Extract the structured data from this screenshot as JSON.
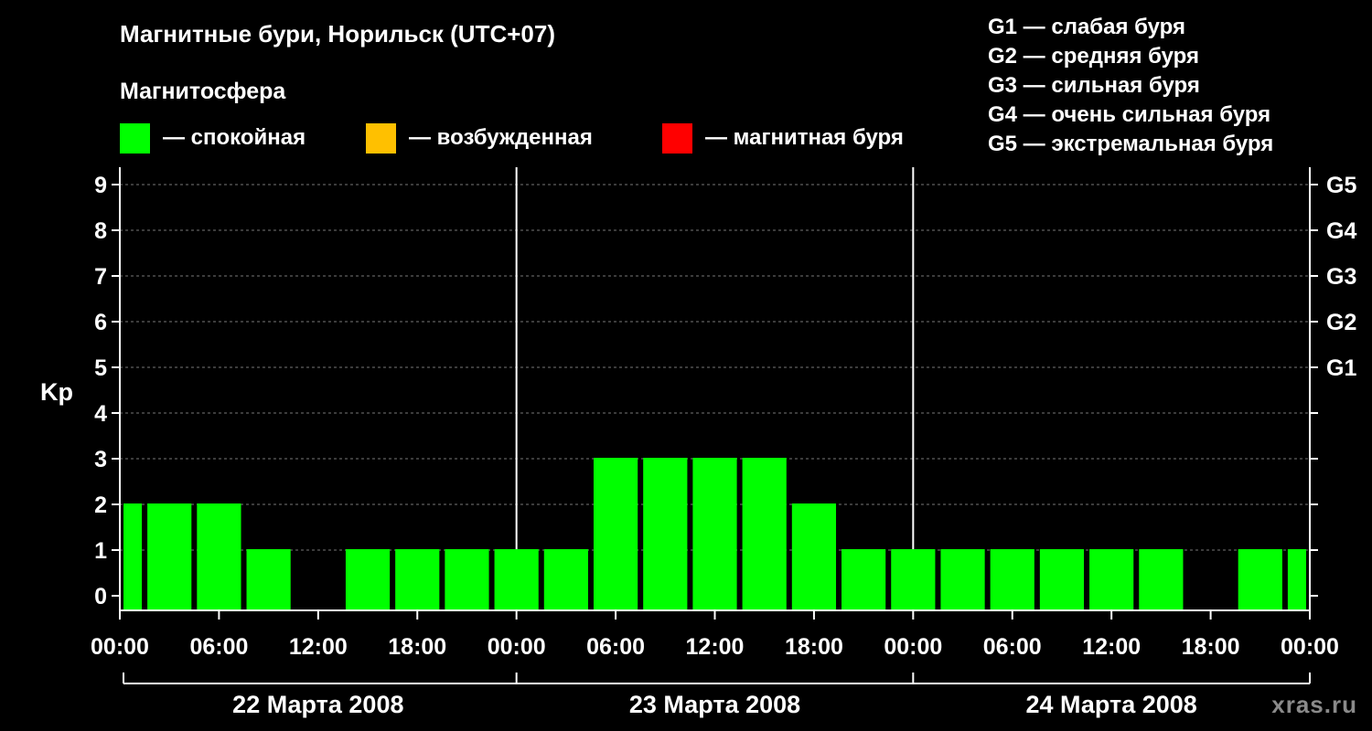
{
  "title": "Магнитные бури, Норильск (UTC+07)",
  "subtitle": "Магнитосфера",
  "legend": [
    {
      "label": "— спокойная",
      "color": "#00ff00"
    },
    {
      "label": "— возбужденная",
      "color": "#ffc000"
    },
    {
      "label": "— магнитная буря",
      "color": "#ff0000"
    }
  ],
  "g_legend": [
    "G1 — слабая буря",
    "G2 — средняя буря",
    "G3 — сильная буря",
    "G4 — очень сильная буря",
    "G5 — экстремальная буря"
  ],
  "watermark": "xras.ru",
  "chart_data": {
    "type": "bar",
    "ylabel": "Kp",
    "ylim": [
      0,
      9
    ],
    "y_ticks": [
      "0",
      "1",
      "2",
      "3",
      "4",
      "5",
      "6",
      "7",
      "8",
      "9"
    ],
    "right_ticks": [
      {
        "y": 5,
        "label": "G1"
      },
      {
        "y": 6,
        "label": "G2"
      },
      {
        "y": 7,
        "label": "G3"
      },
      {
        "y": 8,
        "label": "G4"
      },
      {
        "y": 9,
        "label": "G5"
      }
    ],
    "x_tick_labels": [
      "00:00",
      "06:00",
      "12:00",
      "18:00",
      "00:00",
      "06:00",
      "12:00",
      "18:00",
      "00:00",
      "06:00",
      "12:00",
      "18:00",
      "00:00"
    ],
    "days": [
      "22 Марта 2008",
      "23 Марта 2008",
      "24 Марта 2008"
    ],
    "bar_interval_hours": 3,
    "values": [
      2,
      2,
      2,
      1,
      null,
      1,
      1,
      1,
      1,
      1,
      3,
      3,
      3,
      3,
      2,
      1,
      1,
      1,
      1,
      1,
      1,
      1,
      null,
      1,
      1
    ],
    "bar_color": "#00ff00",
    "grid": "dashed horizontal at each Kp level"
  }
}
